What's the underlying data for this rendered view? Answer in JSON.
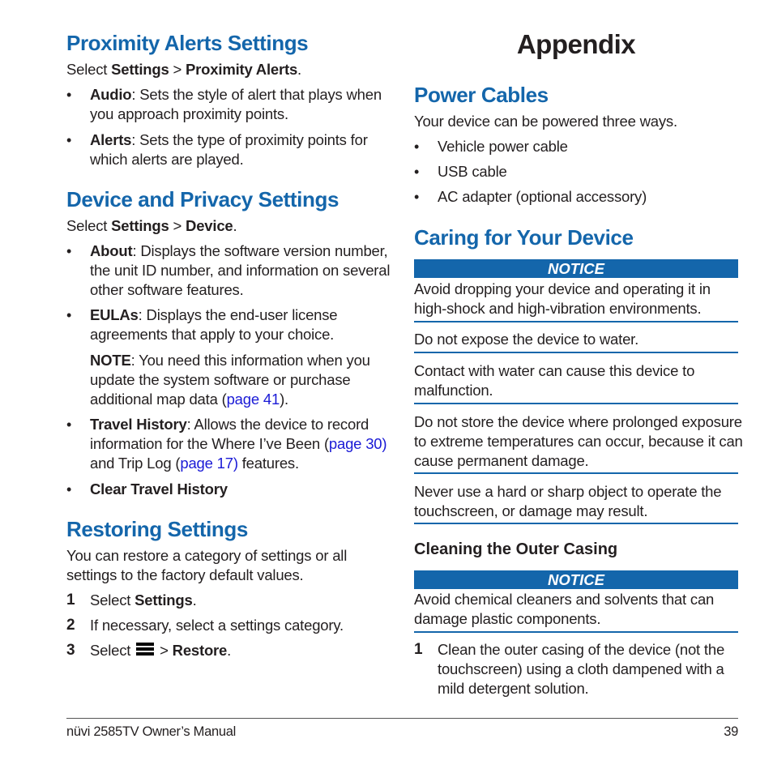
{
  "left": {
    "proximity": {
      "heading": "Proximity Alerts Settings",
      "select_prefix": "Select ",
      "select_a": "Settings",
      "sep": " > ",
      "select_b": "Proximity Alerts",
      "select_suffix": ".",
      "items": [
        {
          "term": "Audio",
          "line1": ": Sets the style of alert that plays when",
          "line2": "you approach proximity points."
        },
        {
          "term": "Alerts",
          "line1": ": Sets the type of proximity points for",
          "line2": "which alerts are played."
        }
      ]
    },
    "device": {
      "heading": "Device and Privacy Settings",
      "select_prefix": "Select ",
      "select_a": "Settings",
      "sep": " > ",
      "select_b": "Device",
      "select_suffix": ".",
      "about": {
        "term": "About",
        "line1": ": Displays the software version number,",
        "line2": "the unit ID number, and information on several",
        "line3": "other software features."
      },
      "eulas": {
        "term": "EULAs",
        "line1": ": Displays the end-user license",
        "line2": "agreements that apply to your choice."
      },
      "note": {
        "term": "NOTE",
        "line1": ": You need this information when you",
        "line2": "update the system software or purchase",
        "line3_prefix": "additional map data (",
        "link": "page 41",
        "line3_suffix": ")."
      },
      "travel": {
        "term": "Travel History",
        "line1": ": Allows the device to record",
        "line2_prefix": "information for the Where I’ve Been (",
        "link1": "page 30)",
        "line3_prefix": "and Trip Log (",
        "link2": "page 17)",
        "line3_suffix": " features."
      },
      "clear": {
        "term": "Clear Travel History"
      }
    },
    "restoring": {
      "heading": "Restoring Settings",
      "intro1": "You can restore a category of settings or all",
      "intro2": "settings to the factory default values.",
      "steps": [
        {
          "num": "1",
          "prefix": "Select ",
          "bold": "Settings",
          "suffix": "."
        },
        {
          "num": "2",
          "text": "If necessary, select a settings category."
        },
        {
          "num": "3",
          "prefix": "Select ",
          "icon": "menu-icon",
          "mid": " > ",
          "bold": "Restore",
          "suffix": "."
        }
      ]
    }
  },
  "right": {
    "title": "Appendix",
    "power": {
      "heading": "Power Cables",
      "intro": "Your device can be powered three ways.",
      "items": [
        "Vehicle power cable",
        "USB cable",
        "AC adapter (optional accessory)"
      ]
    },
    "caring": {
      "heading": "Caring for Your Device",
      "notice_label": "NOTICE",
      "notices": [
        {
          "line1": "Avoid dropping your device and operating it in",
          "line2": "high-shock and high-vibration environments."
        },
        {
          "line1": "Do not expose the device to water."
        },
        {
          "line1": "Contact with water can cause this device to",
          "line2": "malfunction."
        },
        {
          "line1": "Do not store the device where prolonged exposure",
          "line2": "to extreme temperatures can occur, because it can",
          "line3": "cause permanent damage."
        },
        {
          "line1": "Never use a hard or sharp object to operate the",
          "line2": "touchscreen, or damage may result."
        }
      ]
    },
    "cleaning": {
      "heading": "Cleaning the Outer Casing",
      "notice_label": "NOTICE",
      "notice": {
        "line1": "Avoid chemical cleaners and solvents that can",
        "line2": "damage plastic components."
      },
      "steps": [
        {
          "num": "1",
          "line1": "Clean the outer casing of the device (not the",
          "line2": "touchscreen) using a cloth dampened with a",
          "line3": "mild detergent solution."
        }
      ]
    }
  },
  "footer": {
    "manual_title": "nüvi 2585TV Owner’s Manual",
    "page_number": "39"
  },
  "colors": {
    "heading_blue": "#1466ab",
    "link_blue": "#1a1ad6",
    "text": "#231f20"
  }
}
